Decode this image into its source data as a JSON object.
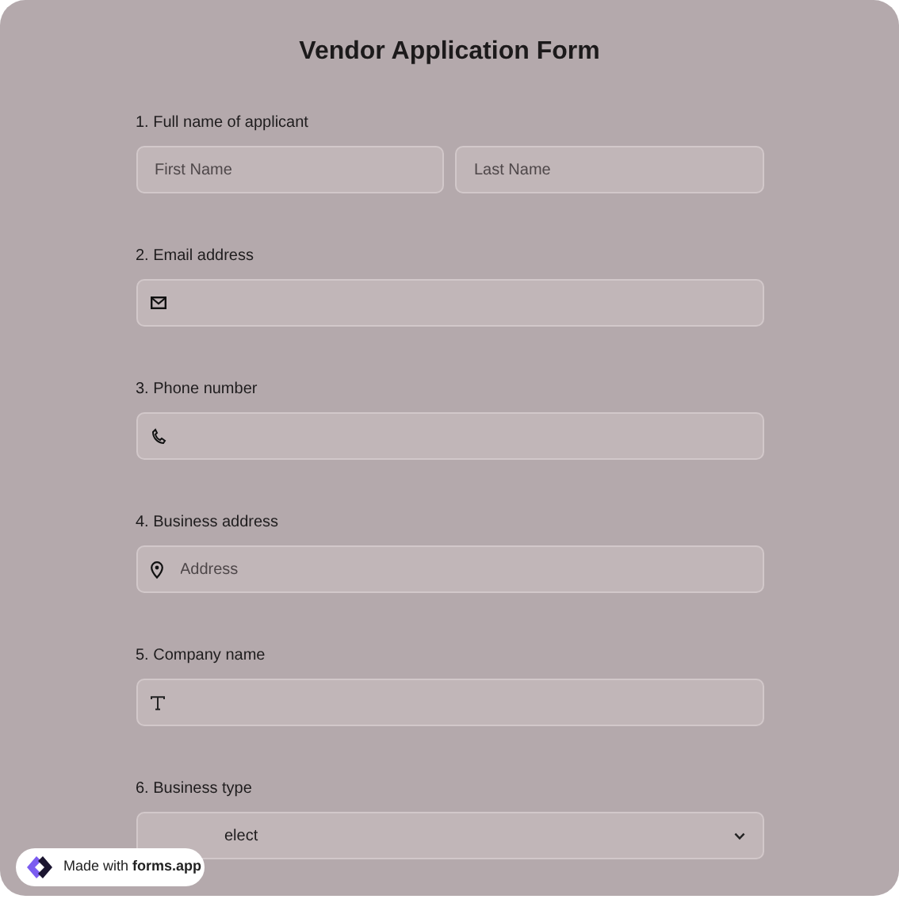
{
  "title": "Vendor Application Form",
  "questions": [
    {
      "label": "1. Full name of applicant",
      "kind": "name",
      "placeholders": [
        "First Name",
        "Last Name"
      ]
    },
    {
      "label": "2. Email address",
      "kind": "email"
    },
    {
      "label": "3. Phone number",
      "kind": "phone"
    },
    {
      "label": "4. Business address",
      "kind": "address",
      "placeholder": "Address"
    },
    {
      "label": "5. Company name",
      "kind": "text"
    },
    {
      "label": "6. Business type",
      "kind": "select",
      "value": "elect"
    }
  ],
  "badge": "Made with **forms.app**"
}
